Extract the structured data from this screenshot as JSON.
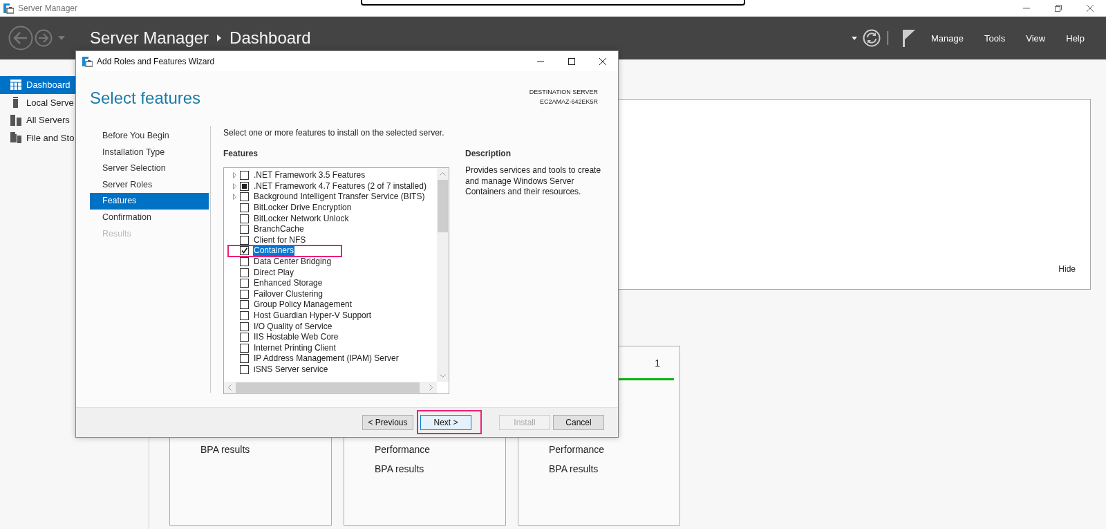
{
  "app_title": "Server Manager",
  "header": {
    "breadcrumb": [
      "Server Manager",
      "Dashboard"
    ],
    "menus": [
      "Manage",
      "Tools",
      "View",
      "Help"
    ]
  },
  "sidebar": {
    "items": [
      {
        "label": "Dashboard",
        "selected": true
      },
      {
        "label": "Local Serve",
        "selected": false
      },
      {
        "label": "All Servers",
        "selected": false
      },
      {
        "label": "File and Sto",
        "selected": false
      }
    ]
  },
  "welcome_panel": {
    "hide_link": "Hide"
  },
  "tiles": [
    {
      "rows": [
        "BPA results"
      ]
    },
    {
      "rows": [
        "Performance",
        "BPA results"
      ]
    },
    {
      "count": "1",
      "rows": [
        "Performance",
        "BPA results"
      ]
    }
  ],
  "wizard": {
    "title": "Add Roles and Features Wizard",
    "heading": "Select features",
    "destination_label": "DESTINATION SERVER",
    "destination_server": "EC2AMAZ-642EK5R",
    "steps": [
      {
        "label": "Before You Begin",
        "selected": false,
        "disabled": false
      },
      {
        "label": "Installation Type",
        "selected": false,
        "disabled": false
      },
      {
        "label": "Server Selection",
        "selected": false,
        "disabled": false
      },
      {
        "label": "Server Roles",
        "selected": false,
        "disabled": false
      },
      {
        "label": "Features",
        "selected": true,
        "disabled": false
      },
      {
        "label": "Confirmation",
        "selected": false,
        "disabled": false
      },
      {
        "label": "Results",
        "selected": false,
        "disabled": true
      }
    ],
    "instruction": "Select one or more features to install on the selected server.",
    "features_heading": "Features",
    "features": [
      {
        "kind": "checkbox",
        "label": ".NET Framework 3.5 Features",
        "expandable": true,
        "checked": false,
        "selected": false
      },
      {
        "kind": "mixed",
        "label": ".NET Framework 4.7 Features (2 of 7 installed)",
        "expandable": true,
        "checked": false,
        "selected": false
      },
      {
        "kind": "checkbox",
        "label": "Background Intelligent Transfer Service (BITS)",
        "expandable": true,
        "checked": false,
        "selected": false
      },
      {
        "kind": "checkbox",
        "label": "BitLocker Drive Encryption",
        "expandable": false,
        "checked": false,
        "selected": false
      },
      {
        "kind": "checkbox",
        "label": "BitLocker Network Unlock",
        "expandable": false,
        "checked": false,
        "selected": false
      },
      {
        "kind": "checkbox",
        "label": "BranchCache",
        "expandable": false,
        "checked": false,
        "selected": false
      },
      {
        "kind": "checkbox",
        "label": "Client for NFS",
        "expandable": false,
        "checked": false,
        "selected": false
      },
      {
        "kind": "checkbox",
        "label": "Containers",
        "expandable": false,
        "checked": true,
        "selected": true
      },
      {
        "kind": "checkbox",
        "label": "Data Center Bridging",
        "expandable": false,
        "checked": false,
        "selected": false
      },
      {
        "kind": "checkbox",
        "label": "Direct Play",
        "expandable": false,
        "checked": false,
        "selected": false
      },
      {
        "kind": "checkbox",
        "label": "Enhanced Storage",
        "expandable": false,
        "checked": false,
        "selected": false
      },
      {
        "kind": "checkbox",
        "label": "Failover Clustering",
        "expandable": false,
        "checked": false,
        "selected": false
      },
      {
        "kind": "checkbox",
        "label": "Group Policy Management",
        "expandable": false,
        "checked": false,
        "selected": false
      },
      {
        "kind": "checkbox",
        "label": "Host Guardian Hyper-V Support",
        "expandable": false,
        "checked": false,
        "selected": false
      },
      {
        "kind": "checkbox",
        "label": "I/O Quality of Service",
        "expandable": false,
        "checked": false,
        "selected": false
      },
      {
        "kind": "checkbox",
        "label": "IIS Hostable Web Core",
        "expandable": false,
        "checked": false,
        "selected": false
      },
      {
        "kind": "checkbox",
        "label": "Internet Printing Client",
        "expandable": false,
        "checked": false,
        "selected": false
      },
      {
        "kind": "checkbox",
        "label": "IP Address Management (IPAM) Server",
        "expandable": false,
        "checked": false,
        "selected": false
      },
      {
        "kind": "checkbox",
        "label": "iSNS Server service",
        "expandable": false,
        "checked": false,
        "selected": false
      }
    ],
    "description_heading": "Description",
    "description": "Provides services and tools to create and manage Windows Server Containers and their resources.",
    "buttons": [
      {
        "label": "< Previous",
        "disabled": false,
        "focused": false
      },
      {
        "label": "Next >",
        "disabled": false,
        "focused": true
      },
      {
        "label": "Install",
        "disabled": true,
        "focused": false
      },
      {
        "label": "Cancel",
        "disabled": false,
        "focused": false
      }
    ]
  }
}
